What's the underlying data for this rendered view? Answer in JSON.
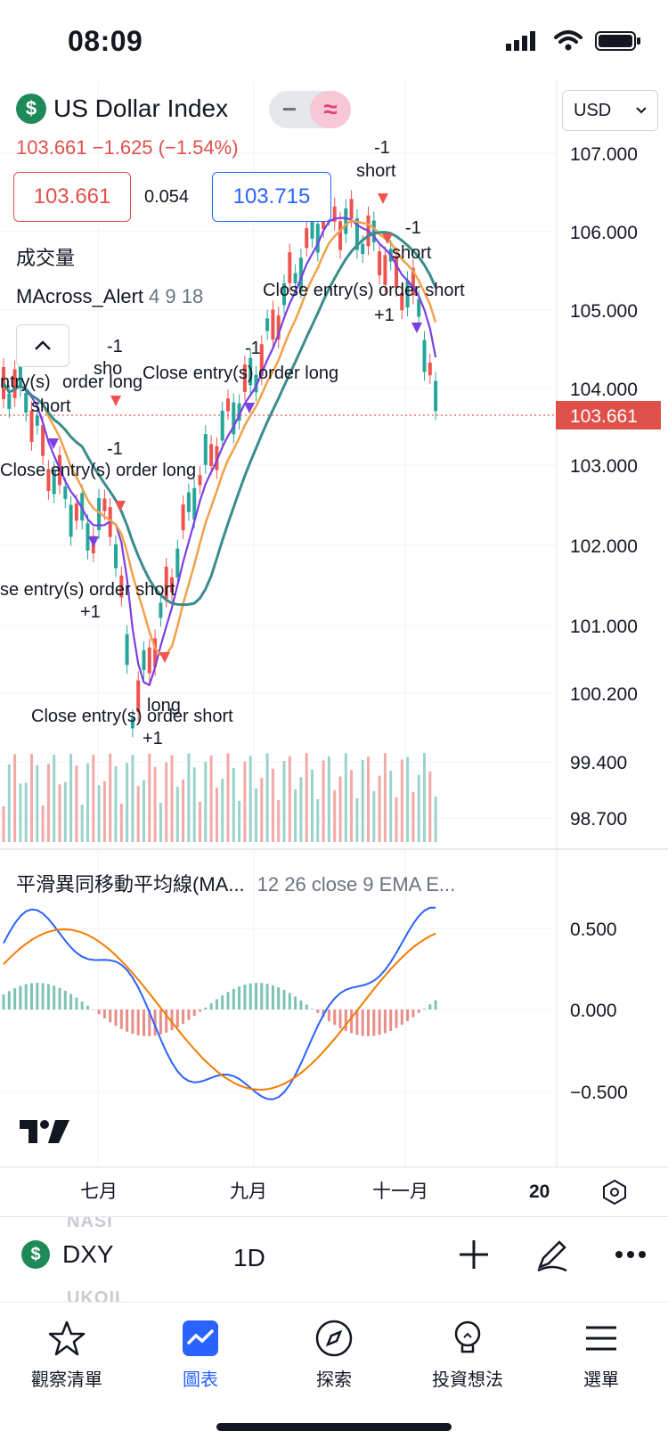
{
  "status_bar": {
    "time": "08:09"
  },
  "header": {
    "symbol_title": "US Dollar Index",
    "currency_icon": "dollar-coin-icon",
    "price_change_line": "103.661  −1.625 (−1.54%)",
    "bid": "103.661",
    "spread": "0.054",
    "ask": "103.715",
    "volume_label": "成交量",
    "indicator_name": "MAcross_Alert",
    "indicator_params": "4 9 18",
    "currency_select": "USD"
  },
  "price_axis": {
    "labels": [
      "107.000",
      "106.000",
      "105.000",
      "104.000",
      "103.000",
      "102.000",
      "101.000",
      "100.200",
      "99.400",
      "98.700"
    ],
    "last_price": "103.661",
    "last_price_color": "#e0504a"
  },
  "annotations": [
    "-1",
    "short",
    "-1",
    "short",
    "Close entry(s) order short",
    "+1",
    "-1",
    "sho",
    "Close entry(s) order long",
    "-1",
    "-1",
    "ntry(s)",
    "order long",
    "short",
    "-1",
    "Close entry(s) order long",
    "se entry(s) order short",
    "+1",
    "long",
    "Close entry(s) order short",
    "+1"
  ],
  "macd": {
    "label": "平滑異同移動平均線(MA...",
    "params": "12 26 close 9 EMA E...",
    "axis_labels": [
      "0.500",
      "0.000",
      "−0.500"
    ]
  },
  "time_axis": {
    "labels": [
      "七月",
      "九月",
      "十一月",
      "20"
    ]
  },
  "symbol_bar": {
    "symbol": "DXY",
    "interval": "1D",
    "ghost_above": "NASI",
    "ghost_below": "UKOIL"
  },
  "tabs": [
    {
      "label": "觀察清單",
      "icon": "star-icon"
    },
    {
      "label": "圖表",
      "icon": "chart-icon",
      "active": true
    },
    {
      "label": "探索",
      "icon": "compass-icon"
    },
    {
      "label": "投資想法",
      "icon": "lightbulb-icon"
    },
    {
      "label": "選單",
      "icon": "menu-icon"
    }
  ],
  "colors": {
    "up": "#26a69a",
    "down": "#ef5350",
    "accent": "#2962ff",
    "ma_fast": "#7b3fe4",
    "ma_mid": "#f2a14a",
    "ma_slow": "#3b8c8c"
  }
}
